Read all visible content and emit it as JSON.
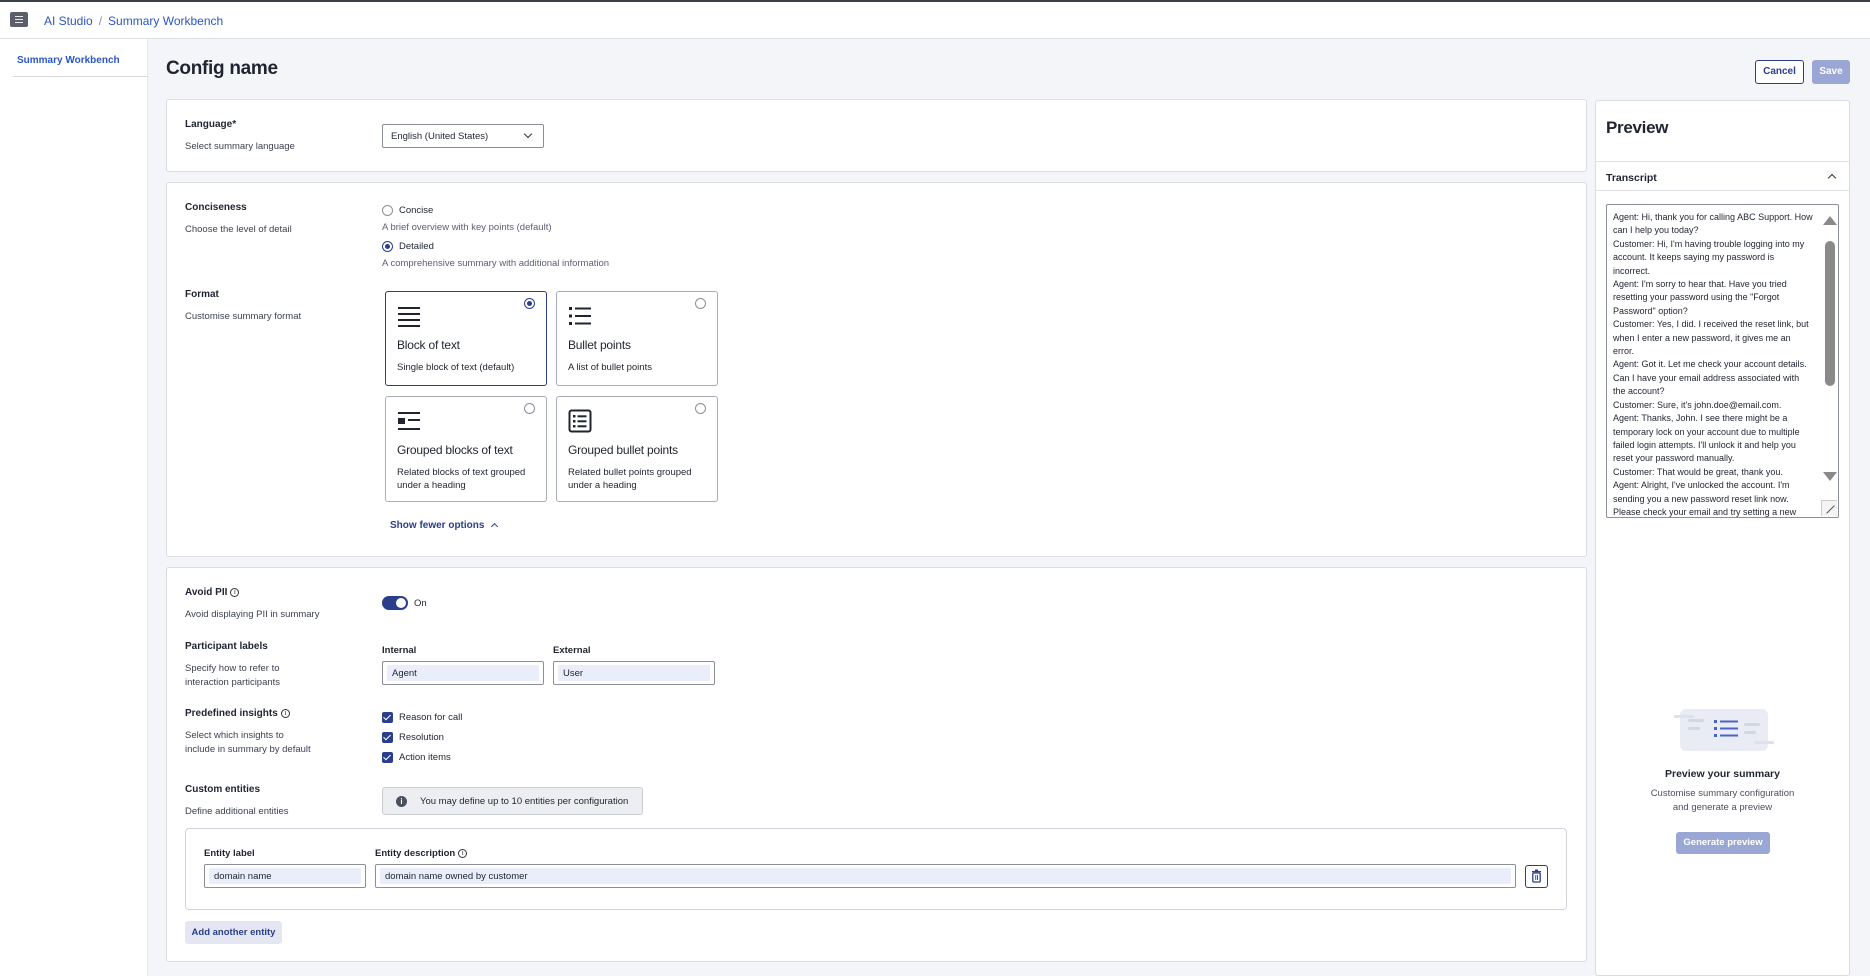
{
  "breadcrumb": {
    "root": "AI Studio",
    "separator": "/",
    "current": "Summary Workbench"
  },
  "sidebar": {
    "items": [
      {
        "label": "Summary Workbench"
      }
    ]
  },
  "page": {
    "title": "Config name"
  },
  "header_actions": {
    "cancel": "Cancel",
    "save": "Save"
  },
  "language": {
    "label": "Language*",
    "description": "Select summary language",
    "value": "English (United States)"
  },
  "conciseness": {
    "label": "Conciseness",
    "description": "Choose the level of detail",
    "options": [
      {
        "label": "Concise",
        "hint": "A brief overview with key points (default)",
        "selected": false
      },
      {
        "label": "Detailed",
        "hint": "A comprehensive summary with additional information",
        "selected": true
      }
    ]
  },
  "format": {
    "label": "Format",
    "description": "Customise summary format",
    "options": [
      {
        "title": "Block of text",
        "desc": "Single block of text (default)",
        "icon": "block-text-icon",
        "selected": true
      },
      {
        "title": "Bullet points",
        "desc": "A list of bullet points",
        "icon": "bullet-list-icon",
        "selected": false
      },
      {
        "title": "Grouped blocks of text",
        "desc": "Related blocks of text grouped under a heading",
        "icon": "grouped-text-icon",
        "selected": false
      },
      {
        "title": "Grouped bullet points",
        "desc": "Related bullet points grouped under a heading",
        "icon": "grouped-bullets-icon",
        "selected": false
      }
    ],
    "toggle_link": "Show fewer options"
  },
  "avoid_pii": {
    "label": "Avoid PII",
    "description": "Avoid displaying PII in summary",
    "state": "On"
  },
  "participant_labels": {
    "label": "Participant labels",
    "description": "Specify how to refer to interaction participants",
    "internal_label": "Internal",
    "internal_value": "Agent",
    "external_label": "External",
    "external_value": "User"
  },
  "insights": {
    "label": "Predefined insights",
    "description": "Select which insights to include in summary by default",
    "items": [
      "Reason for call",
      "Resolution",
      "Action items"
    ]
  },
  "custom_entities": {
    "label": "Custom entities",
    "description": "Define additional entities",
    "info": "You may define up to 10 entities per configuration",
    "entity_label_title": "Entity label",
    "entity_desc_title": "Entity description",
    "entity_label_value": "domain name",
    "entity_desc_value": "domain name owned by customer",
    "add_button": "Add another entity"
  },
  "preview": {
    "title": "Preview",
    "tab": "Transcript",
    "transcript": "Agent: Hi, thank you for calling ABC Support. How can I help you today?\nCustomer: Hi, I'm having trouble logging into my account. It keeps saying my password is incorrect.\nAgent: I'm sorry to hear that. Have you tried resetting your password using the \"Forgot Password\" option?\nCustomer: Yes, I did. I received the reset link, but when I enter a new password, it gives me an error.\nAgent: Got it. Let me check your account details. Can I have your email address associated with the account?\nCustomer: Sure, it's john.doe@email.com.\nAgent: Thanks, John. I see there might be a temporary lock on your account due to multiple failed login attempts. I'll unlock it and help you reset your password manually.\nCustomer: That would be great, thank you.\nAgent: Alright, I've unlocked the account. I'm sending you a new password reset link now. Please check your email and try setting a new",
    "empty_title": "Preview your summary",
    "empty_sub": "Customise summary configuration and generate a preview",
    "generate": "Generate preview"
  },
  "colors": {
    "accent": "#2a3e8c",
    "link": "#2a56c6",
    "disabled_button": "#9aa6d4"
  }
}
